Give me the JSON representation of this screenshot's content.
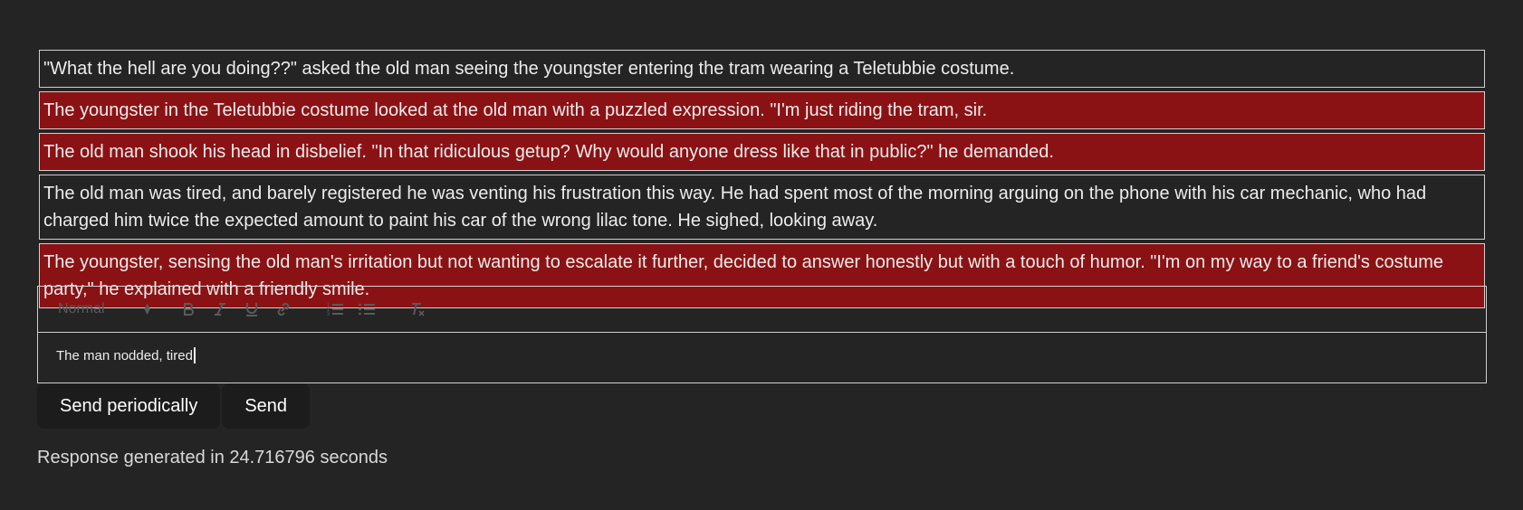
{
  "messages": [
    {
      "role": "user",
      "text": "\"What the hell are you doing??\" asked the old man seeing the youngster entering the tram wearing a Teletubbie costume."
    },
    {
      "role": "ai",
      "text": "The youngster in the Teletubbie costume looked at the old man with a puzzled expression. \"I'm just riding the tram, sir."
    },
    {
      "role": "ai",
      "text": "The old man shook his head in disbelief. \"In that ridiculous getup? Why would anyone dress like that in public?\" he demanded."
    },
    {
      "role": "user",
      "text": "The old man was tired, and barely registered he was venting his frustration this way. He had spent most of the morning arguing on the phone with his car mechanic, who had charged him twice the expected amount to paint his car of the wrong lilac tone. He sighed, looking away."
    },
    {
      "role": "ai",
      "text": "The youngster, sensing the old man's irritation but not wanting to escalate it further, decided to answer honestly but with a touch of humor. \"I'm on my way to a friend's costume party,\" he explained with a friendly smile."
    }
  ],
  "editor": {
    "format_select": "Normal",
    "toolbar_icons": [
      "bold-icon",
      "italic-icon",
      "underline-icon",
      "link-icon",
      "ordered-list-icon",
      "bullet-list-icon",
      "clear-format-icon"
    ],
    "content": "The man nodded, tired"
  },
  "actions": {
    "send_periodically": "Send periodically",
    "send": "Send"
  },
  "status": "Response generated in 24.716796 seconds",
  "colors": {
    "background": "#242424",
    "ai_message": "#8b1214",
    "border": "#cfcfcf",
    "button": "#1c1c1c"
  }
}
